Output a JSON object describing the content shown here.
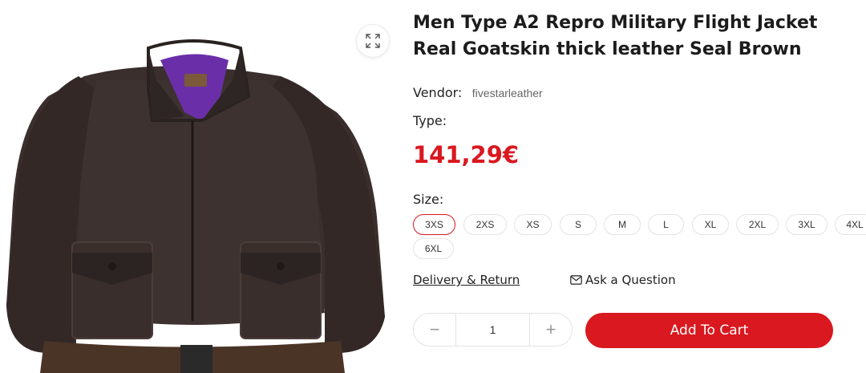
{
  "product": {
    "title": "Men Type A2 Repro Military Flight Jacket Real Goatskin thick leather Seal Brown",
    "vendor_label": "Vendor:",
    "vendor_value": "fivestarleather",
    "type_label": "Type:",
    "price": "141,29€"
  },
  "size_selector": {
    "label": "Size:",
    "selected": "3XS",
    "options": [
      "3XS",
      "2XS",
      "XS",
      "S",
      "M",
      "L",
      "XL",
      "2XL",
      "3XL",
      "4XL",
      "6XL"
    ]
  },
  "links": {
    "delivery": "Delivery & Return",
    "ask": "Ask a Question"
  },
  "quantity": {
    "minus": "−",
    "value": "1",
    "plus": "+"
  },
  "cart": {
    "label": "Add To Cart"
  },
  "image": {
    "icon": "jacket-image",
    "zoom_icon": "expand-icon"
  },
  "colors": {
    "accent": "#d9181f",
    "jacket": "#3a2f2c",
    "lining": "#6a2fa8"
  }
}
